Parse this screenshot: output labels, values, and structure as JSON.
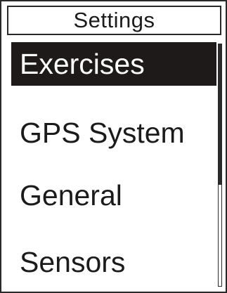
{
  "header": {
    "title": "Settings"
  },
  "menu": {
    "items": [
      {
        "label": "Exercises",
        "selected": true
      },
      {
        "label": "GPS System",
        "selected": false
      },
      {
        "label": "General",
        "selected": false
      },
      {
        "label": "Sensors",
        "selected": false
      }
    ]
  },
  "scrollbar": {
    "position_fraction": 0.0,
    "visible_fraction": 0.58
  }
}
